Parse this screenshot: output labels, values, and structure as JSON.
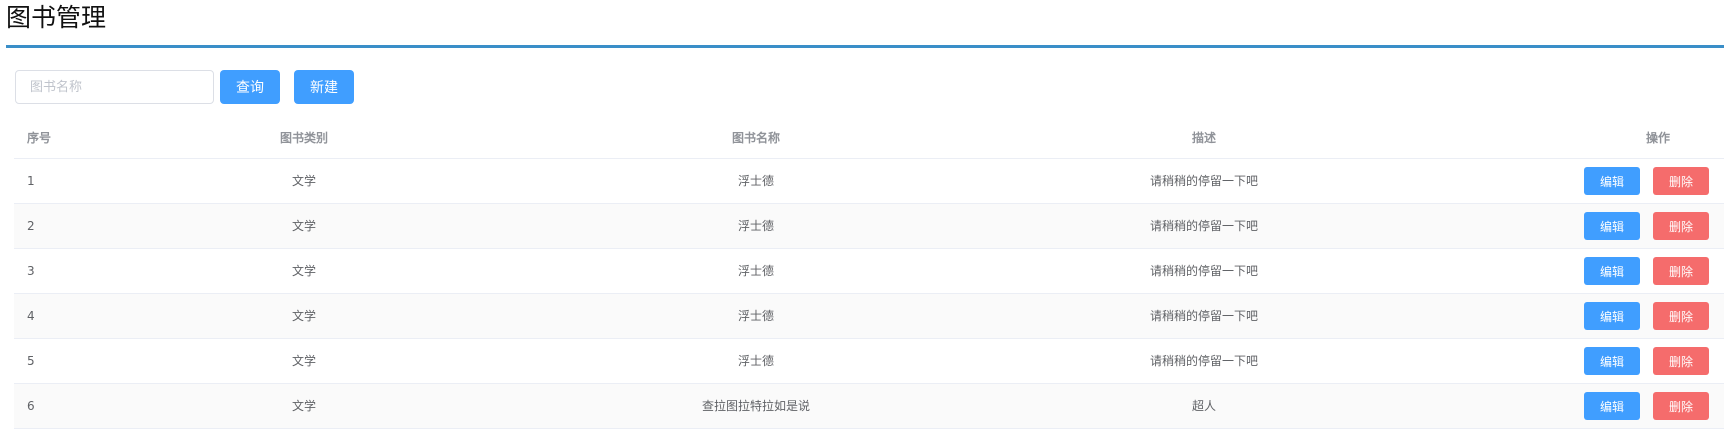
{
  "page": {
    "title": "图书管理"
  },
  "toolbar": {
    "search_placeholder": "图书名称",
    "search_value": "",
    "search_label": "查询",
    "new_label": "新建"
  },
  "table": {
    "columns": {
      "index": "序号",
      "category": "图书类别",
      "name": "图书名称",
      "description": "描述",
      "operations": "操作"
    },
    "rows": [
      {
        "index": "1",
        "category": "文学",
        "name": "浮士德",
        "description": "请稍稍的停留一下吧",
        "edit": "编辑",
        "delete": "删除"
      },
      {
        "index": "2",
        "category": "文学",
        "name": "浮士德",
        "description": "请稍稍的停留一下吧",
        "edit": "编辑",
        "delete": "删除"
      },
      {
        "index": "3",
        "category": "文学",
        "name": "浮士德",
        "description": "请稍稍的停留一下吧",
        "edit": "编辑",
        "delete": "删除"
      },
      {
        "index": "4",
        "category": "文学",
        "name": "浮士德",
        "description": "请稍稍的停留一下吧",
        "edit": "编辑",
        "delete": "删除"
      },
      {
        "index": "5",
        "category": "文学",
        "name": "浮士德",
        "description": "请稍稍的停留一下吧",
        "edit": "编辑",
        "delete": "删除"
      },
      {
        "index": "6",
        "category": "文学",
        "name": "查拉图拉特拉如是说",
        "description": "超人",
        "edit": "编辑",
        "delete": "删除"
      }
    ]
  },
  "colors": {
    "primary": "#409eff",
    "danger": "#f56c6c",
    "title_rule": "#3a8ec8",
    "stripe": "#fafafa"
  }
}
